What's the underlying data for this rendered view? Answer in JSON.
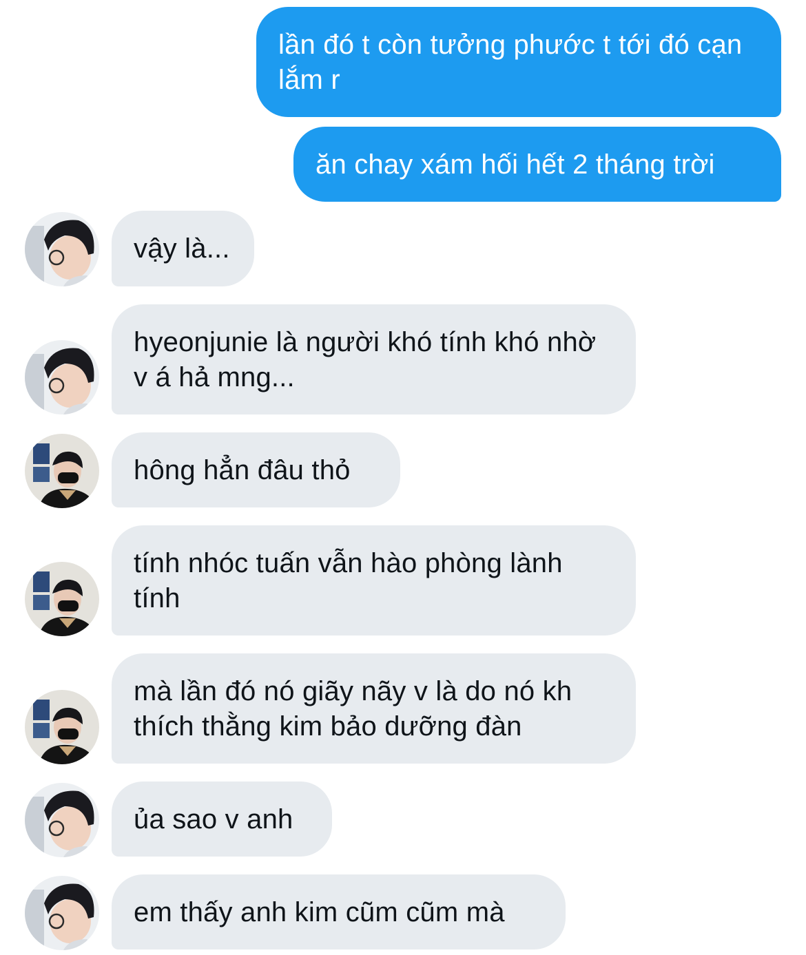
{
  "messages": [
    {
      "direction": "outgoing",
      "text": "lần đó t còn tưởng phước t tới đó cạn lắm r"
    },
    {
      "direction": "outgoing",
      "text": "ăn chay xám hối hết 2 tháng trời"
    },
    {
      "direction": "incoming",
      "avatar": "avatar-a",
      "text": "vậy là..."
    },
    {
      "direction": "incoming",
      "avatar": "avatar-a",
      "text": "hyeonjunie là người khó tính khó nhờ v á hả mng..."
    },
    {
      "direction": "incoming",
      "avatar": "avatar-b",
      "text": "hông hẳn đâu thỏ"
    },
    {
      "direction": "incoming",
      "avatar": "avatar-b",
      "text": "tính nhóc tuấn vẫn hào phòng lành tính"
    },
    {
      "direction": "incoming",
      "avatar": "avatar-b",
      "text": "mà lần đó nó giãy nãy v là do nó kh thích thằng kim bảo dưỡng đàn"
    },
    {
      "direction": "incoming",
      "avatar": "avatar-a",
      "text": "ủa sao v anh"
    },
    {
      "direction": "incoming",
      "avatar": "avatar-a",
      "text": "em thấy anh kim cũm cũm mà"
    }
  ],
  "colors": {
    "outgoing_bubble": "#1d9bf0",
    "incoming_bubble": "#e7ebef",
    "incoming_text": "#0f1419",
    "outgoing_text": "#ffffff"
  }
}
